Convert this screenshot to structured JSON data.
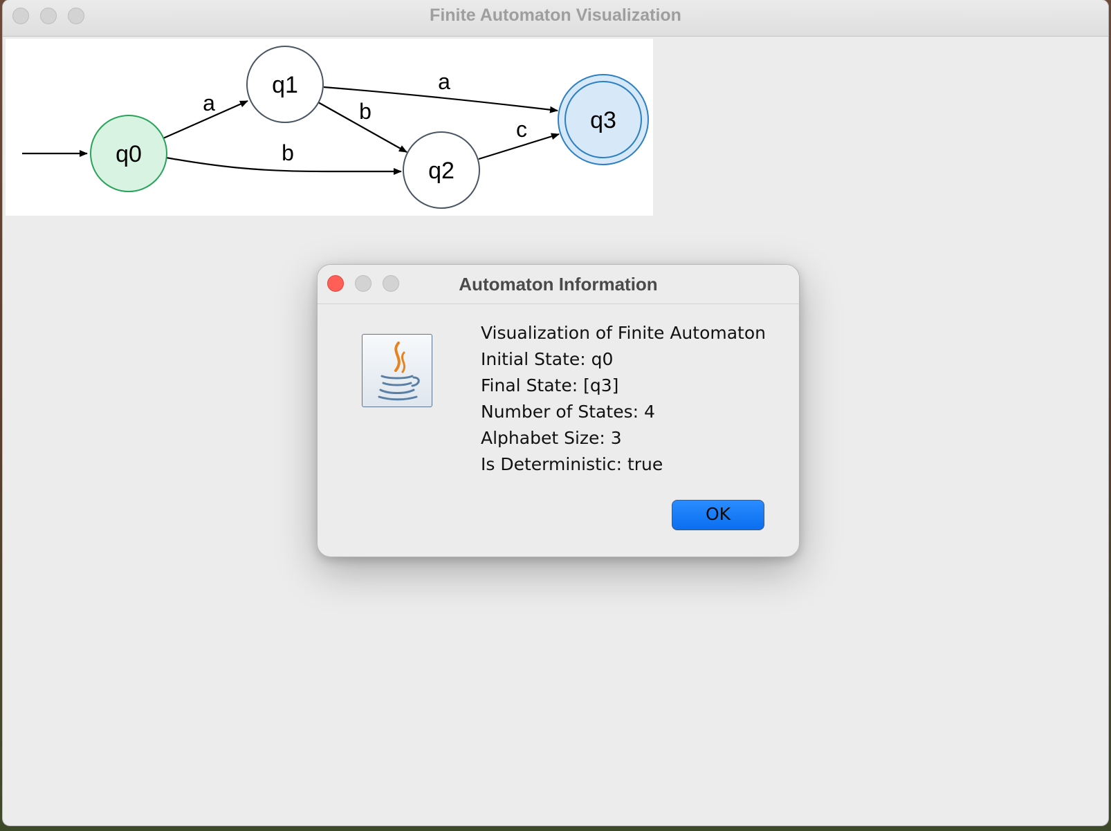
{
  "main_window": {
    "title": "Finite Automaton Visualization"
  },
  "automaton": {
    "states": [
      {
        "id": "q0",
        "label": "q0",
        "kind": "initial"
      },
      {
        "id": "q1",
        "label": "q1",
        "kind": "normal"
      },
      {
        "id": "q2",
        "label": "q2",
        "kind": "normal"
      },
      {
        "id": "q3",
        "label": "q3",
        "kind": "final"
      }
    ],
    "transitions": [
      {
        "from": "q0",
        "to": "q1",
        "label": "a"
      },
      {
        "from": "q0",
        "to": "q2",
        "label": "b"
      },
      {
        "from": "q1",
        "to": "q3",
        "label": "a"
      },
      {
        "from": "q1",
        "to": "q2",
        "label": "b"
      },
      {
        "from": "q2",
        "to": "q3",
        "label": "c"
      }
    ],
    "colors": {
      "initial_fill": "#d8f3e1",
      "initial_stroke": "#27a35a",
      "final_fill": "#d7e8f8",
      "final_stroke": "#2b7fc2",
      "normal_fill": "#ffffff",
      "normal_stroke": "#4a5563"
    }
  },
  "dialog": {
    "title": "Automaton Information",
    "icon": "java-coffee-cup-icon",
    "lines": [
      "Visualization of Finite Automaton",
      "Initial State: q0",
      "Final State: [q3]",
      "Number of States: 4",
      "Alphabet Size: 3",
      "Is Deterministic: true"
    ],
    "ok_label": "OK",
    "colors": {
      "close": "#ff5f57",
      "ok_button": "#0a6ef0"
    }
  }
}
